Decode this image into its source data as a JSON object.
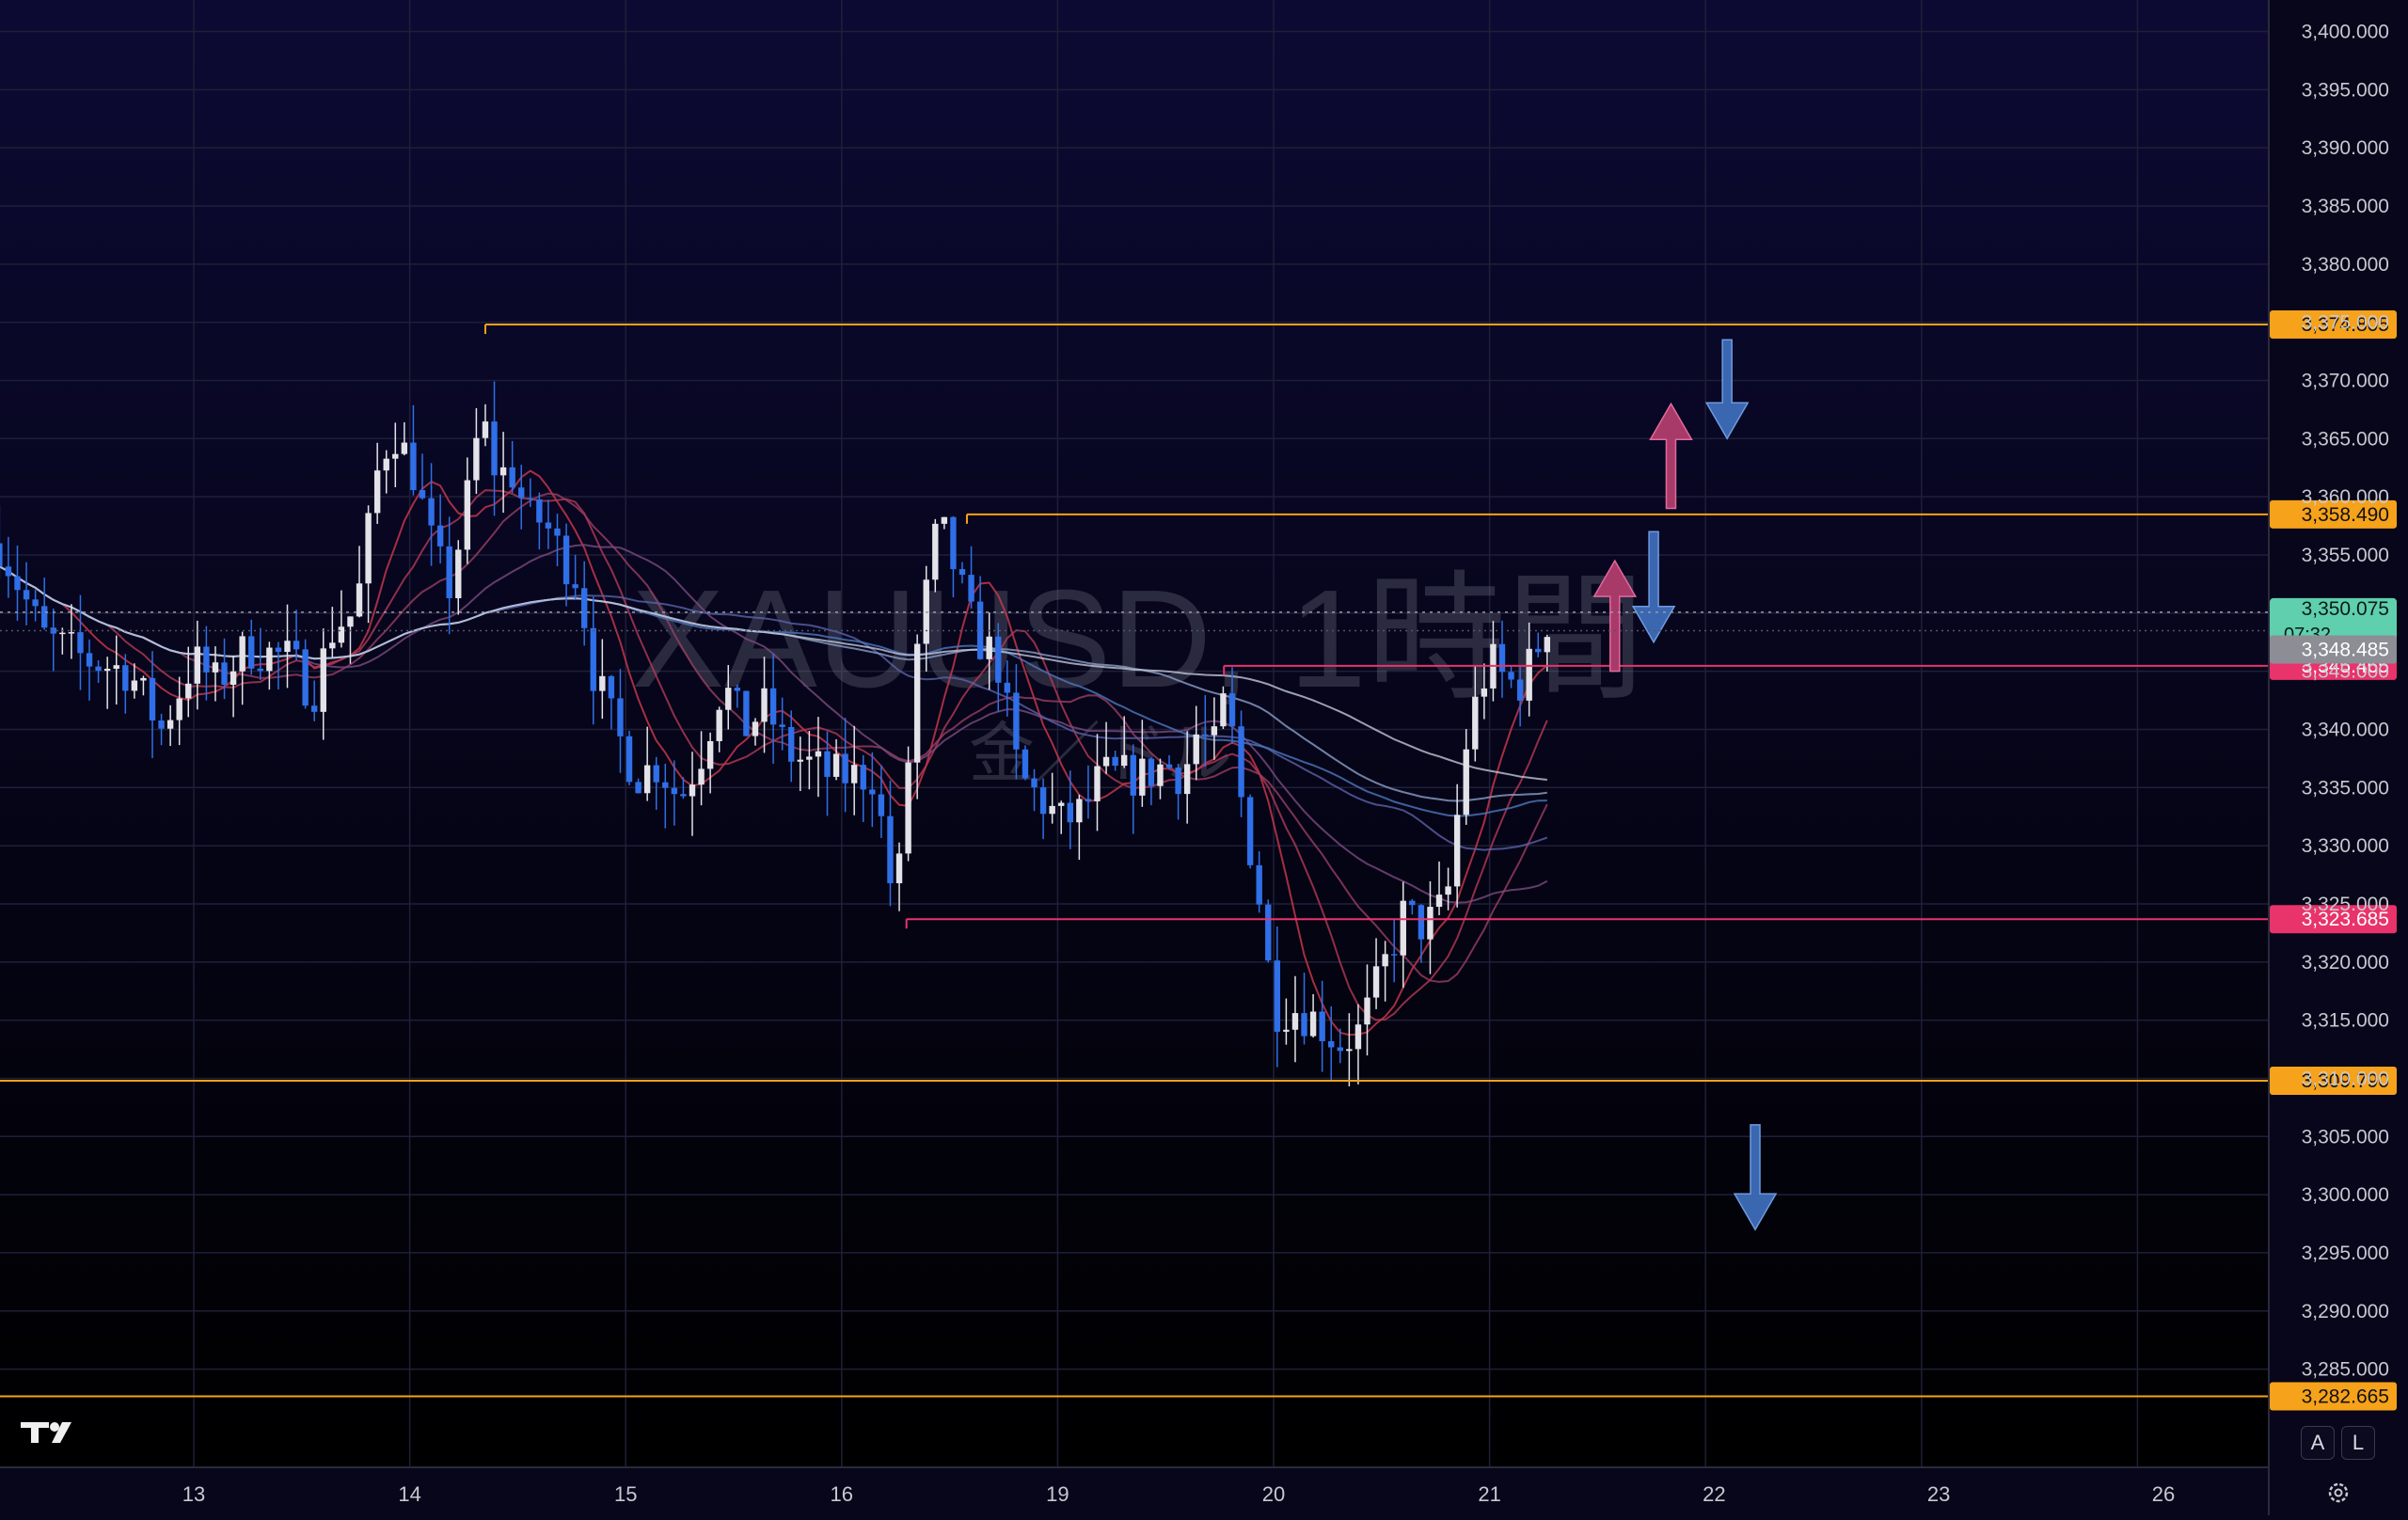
{
  "watermark": {
    "symbol": "XAUUSD, 1時間",
    "subtitle": "金／ドル"
  },
  "colors": {
    "background_top": "#0c0a33",
    "background_bottom": "#000000",
    "grid": "#1f1f38",
    "bull": "#e2e2e8",
    "bear": "#2f6fe8",
    "orange": "#f6a21a",
    "pink": "#e9336b",
    "axis_text": "#c8c8d0"
  },
  "price_axis": {
    "ticks": [
      "3,400.000",
      "3,395.000",
      "3,390.000",
      "3,385.000",
      "3,380.000",
      "3,375.000",
      "3,370.000",
      "3,365.000",
      "3,360.000",
      "3,355.000",
      "3,350.000",
      "3,345.000",
      "3,340.000",
      "3,335.000",
      "3,330.000",
      "3,325.000",
      "3,320.000",
      "3,315.000",
      "3,310.000",
      "3,305.000",
      "3,300.000",
      "3,295.000",
      "3,290.000",
      "3,285.000"
    ]
  },
  "labels": {
    "current_price": "3,350.075",
    "countdown": "07:32",
    "bid_price": "3,348.485"
  },
  "corner_buttons": {
    "auto": "A",
    "log": "L"
  },
  "chart_data": {
    "type": "candlestick",
    "instrument": "XAUUSD",
    "timeframe": "1時間",
    "xlabels": [
      "13",
      "14",
      "15",
      "16",
      "19",
      "20",
      "21",
      "22",
      "23",
      "26"
    ],
    "ylim": [
      3281,
      3402
    ],
    "grid": true,
    "levels": [
      {
        "label": "3,374.805",
        "value": 3374.805,
        "color": "orange",
        "from_day": 1.35
      },
      {
        "label": "3,358.490",
        "value": 3358.49,
        "color": "orange",
        "from_day": 3.58
      },
      {
        "label": "3,345.465",
        "value": 3345.465,
        "color": "pink",
        "from_day": 4.77
      },
      {
        "label": "3,323.685",
        "value": 3323.685,
        "color": "pink",
        "from_day": 3.3
      },
      {
        "label": "3,309.790",
        "value": 3309.79,
        "color": "orange",
        "from_day": -1
      },
      {
        "label": "3,282.665",
        "value": 3282.665,
        "color": "orange",
        "from_day": -1
      }
    ],
    "price_path": [
      [
        -0.9,
        3356
      ],
      [
        -0.7,
        3348
      ],
      [
        -0.5,
        3346
      ],
      [
        -0.3,
        3345
      ],
      [
        -0.15,
        3340
      ],
      [
        0.0,
        3346
      ],
      [
        0.1,
        3344
      ],
      [
        0.25,
        3347
      ],
      [
        0.45,
        3346
      ],
      [
        0.55,
        3343
      ],
      [
        0.65,
        3349
      ],
      [
        0.75,
        3350
      ],
      [
        0.85,
        3362
      ],
      [
        0.92,
        3366
      ],
      [
        1.02,
        3362
      ],
      [
        1.1,
        3356
      ],
      [
        1.18,
        3352
      ],
      [
        1.25,
        3358
      ],
      [
        1.33,
        3367
      ],
      [
        1.4,
        3362
      ],
      [
        1.48,
        3362
      ],
      [
        1.55,
        3358
      ],
      [
        1.62,
        3358
      ],
      [
        1.7,
        3355
      ],
      [
        1.78,
        3353
      ],
      [
        1.85,
        3345
      ],
      [
        1.95,
        3340
      ],
      [
        2.05,
        3336
      ],
      [
        2.15,
        3337
      ],
      [
        2.25,
        3334
      ],
      [
        2.35,
        3338
      ],
      [
        2.45,
        3344
      ],
      [
        2.55,
        3340
      ],
      [
        2.65,
        3342
      ],
      [
        2.75,
        3338
      ],
      [
        2.85,
        3337
      ],
      [
        2.95,
        3336
      ],
      [
        3.05,
        3336
      ],
      [
        3.15,
        3336
      ],
      [
        3.25,
        3324
      ],
      [
        3.35,
        3347
      ],
      [
        3.45,
        3358
      ],
      [
        3.52,
        3354
      ],
      [
        3.62,
        3348
      ],
      [
        3.72,
        3346
      ],
      [
        3.82,
        3336
      ],
      [
        3.92,
        3334
      ],
      [
        4.02,
        3332
      ],
      [
        4.12,
        3333
      ],
      [
        4.2,
        3336
      ],
      [
        4.3,
        3336
      ],
      [
        4.4,
        3336
      ],
      [
        4.5,
        3337
      ],
      [
        4.58,
        3336
      ],
      [
        4.65,
        3340
      ],
      [
        4.72,
        3338
      ],
      [
        4.78,
        3343
      ],
      [
        4.85,
        3334
      ],
      [
        4.93,
        3326
      ],
      [
        5.0,
        3316
      ],
      [
        5.1,
        3316
      ],
      [
        5.2,
        3315
      ],
      [
        5.3,
        3313
      ],
      [
        5.4,
        3314
      ],
      [
        5.5,
        3319
      ],
      [
        5.6,
        3324
      ],
      [
        5.7,
        3323
      ],
      [
        5.8,
        3325
      ],
      [
        5.9,
        3340
      ],
      [
        6.0,
        3346
      ],
      [
        6.08,
        3344
      ],
      [
        6.15,
        3344
      ],
      [
        6.22,
        3347
      ],
      [
        6.28,
        3350
      ]
    ],
    "arrows": [
      {
        "direction": "down",
        "color": "blue",
        "from": 3373.5,
        "to": 3365,
        "day": 7.1
      },
      {
        "direction": "up",
        "color": "pink",
        "from": 3359,
        "to": 3368,
        "day": 6.84
      },
      {
        "direction": "up",
        "color": "pink",
        "from": 3345,
        "to": 3354.5,
        "day": 6.58
      },
      {
        "direction": "down",
        "color": "blue",
        "from": 3357,
        "to": 3347.5,
        "day": 6.76
      },
      {
        "direction": "down",
        "color": "blue",
        "from": 3306,
        "to": 3297,
        "day": 7.23
      }
    ]
  }
}
